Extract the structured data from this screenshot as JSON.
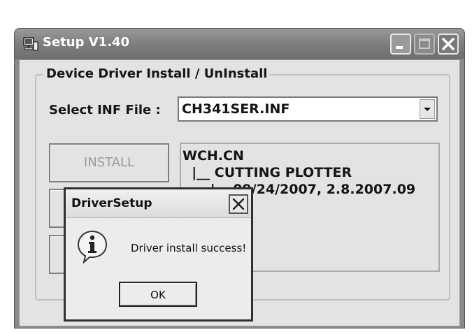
{
  "window": {
    "title": "Setup V1.40",
    "icon": "computer-setup-icon",
    "controls": [
      "minimize-icon",
      "maximize-icon",
      "close-icon"
    ]
  },
  "group": {
    "legend": "Device Driver Install / UnInstall"
  },
  "inf": {
    "label": "Select INF File :",
    "selected": "CH341SER.INF"
  },
  "buttons": {
    "install": "INSTALL"
  },
  "driver_info": {
    "line1": "WCH.CN",
    "line2": "  |__ CUTTING PLOTTER",
    "line3": "      |__ 09/24/2007, 2.8.2007.09"
  },
  "dialog": {
    "title": "DriverSetup",
    "message": "Driver install success!",
    "ok_label": "OK",
    "icon": "information-icon"
  }
}
